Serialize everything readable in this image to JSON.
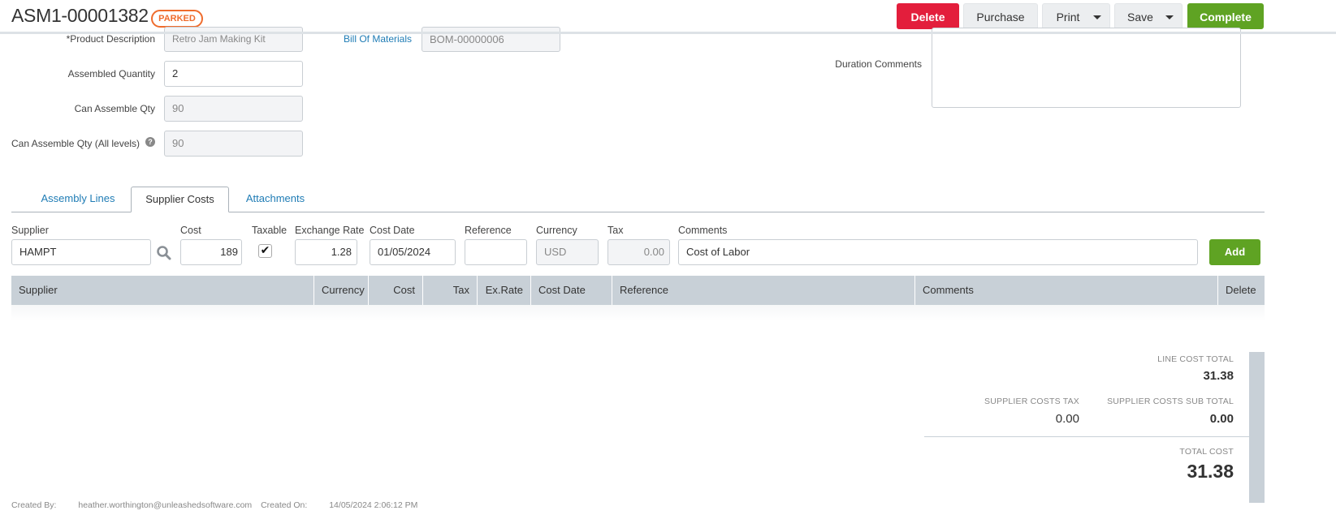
{
  "header": {
    "title": "ASM1-00001382",
    "status": "PARKED",
    "buttons": {
      "delete": "Delete",
      "purchase": "Purchase",
      "print": "Print",
      "save": "Save",
      "complete": "Complete"
    }
  },
  "form": {
    "product_description": {
      "label": "*Product Description",
      "value": "Retro Jam Making Kit"
    },
    "assembled_quantity": {
      "label": "Assembled Quantity",
      "value": "2"
    },
    "can_assemble_qty": {
      "label": "Can Assemble Qty",
      "value": "90"
    },
    "can_assemble_qty_all": {
      "label": "Can Assemble Qty (All levels)",
      "value": "90"
    },
    "bill_of_materials": {
      "label": "Bill Of Materials",
      "value": "BOM-00000006"
    },
    "duration_comments": {
      "label": "Duration Comments",
      "value": ""
    }
  },
  "tabs": [
    {
      "label": "Assembly Lines"
    },
    {
      "label": "Supplier Costs",
      "active": true
    },
    {
      "label": "Attachments"
    }
  ],
  "supplier_form": {
    "supplier": {
      "label": "Supplier",
      "value": "HAMPT"
    },
    "cost": {
      "label": "Cost",
      "value": "189"
    },
    "taxable": {
      "label": "Taxable",
      "checked": true
    },
    "exchange_rate": {
      "label": "Exchange Rate",
      "value": "1.28"
    },
    "cost_date": {
      "label": "Cost Date",
      "value": "01/05/2024"
    },
    "reference": {
      "label": "Reference",
      "value": ""
    },
    "currency": {
      "label": "Currency",
      "value": "USD"
    },
    "tax": {
      "label": "Tax",
      "value": "0.00"
    },
    "comments": {
      "label": "Comments",
      "value": "Cost of Labor"
    },
    "add": "Add"
  },
  "table": {
    "columns": [
      "Supplier",
      "Currency",
      "Cost",
      "Tax",
      "Ex.Rate",
      "Cost Date",
      "Reference",
      "Comments",
      "Delete"
    ],
    "rows": []
  },
  "totals": {
    "line_cost_total_label": "LINE COST TOTAL",
    "line_cost_total": "31.38",
    "supplier_costs_tax_label": "SUPPLIER COSTS TAX",
    "supplier_costs_tax": "0.00",
    "supplier_costs_sub_total_label": "SUPPLIER COSTS SUB TOTAL",
    "supplier_costs_sub_total": "0.00",
    "total_cost_label": "TOTAL COST",
    "total_cost": "31.38"
  },
  "footer": {
    "created_by_label": "Created By:",
    "created_by": "heather.worthington@unleashedsoftware.com",
    "created_on_label": "Created On:",
    "created_on": "14/05/2024 2:06:12 PM"
  },
  "colors": {
    "delete": "#e31e3c",
    "complete": "#5fa323",
    "badge": "#ef6c2d",
    "link": "#1f7cb5",
    "table_header": "#c8d0d7"
  }
}
